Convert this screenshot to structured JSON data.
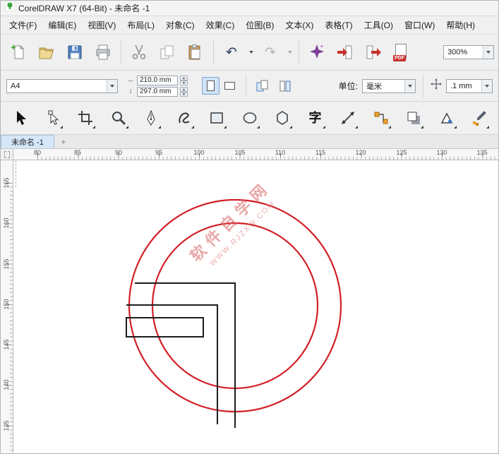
{
  "window": {
    "title": "CorelDRAW X7 (64-Bit) - 未命名 -1"
  },
  "menubar": {
    "items": [
      "文件(F)",
      "编辑(E)",
      "视图(V)",
      "布局(L)",
      "对象(C)",
      "效果(C)",
      "位图(B)",
      "文本(X)",
      "表格(T)",
      "工具(O)",
      "窗口(W)",
      "帮助(H)"
    ]
  },
  "toolbar": {
    "zoom_level": "300%",
    "pdf_label": "PDF"
  },
  "property_bar": {
    "page_size": "A4",
    "paper_width": "210.0 mm",
    "paper_height": "297.0 mm",
    "units_label": "单位:",
    "units_value": "毫米",
    "nudge_value": ".1 mm"
  },
  "tabs": {
    "active": "未命名 -1",
    "new_tab": "+"
  },
  "toolbox": {
    "text_tool_glyph": "字"
  },
  "rulers": {
    "horizontal": [
      "80",
      "85",
      "90",
      "95",
      "100",
      "105",
      "110",
      "115",
      "120",
      "125",
      "130",
      "135"
    ],
    "vertical": [
      "165",
      "160",
      "155",
      "150",
      "145",
      "140",
      "135"
    ]
  },
  "canvas": {
    "watermark_line1": "软件自学网",
    "watermark_line2": "WWW.RJZXW.COM",
    "watermark_color": "#db6e6e",
    "circle_stroke": "#d22027",
    "line_stroke": "#1c1c1c"
  }
}
